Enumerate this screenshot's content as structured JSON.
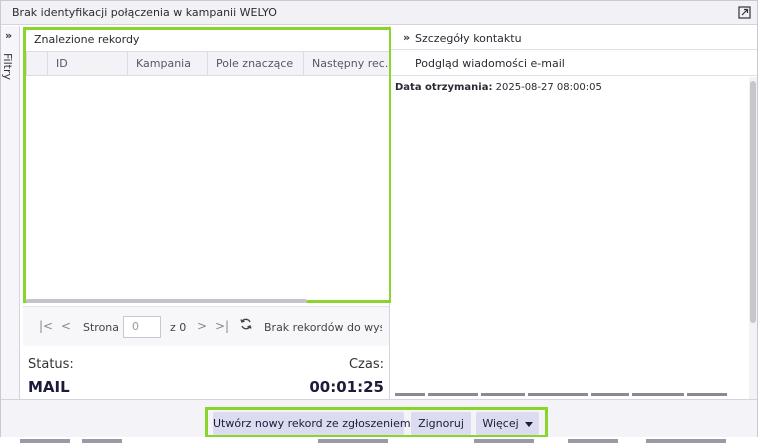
{
  "window": {
    "title": "Brak identyfikacji połączenia w kampanii WELYO"
  },
  "filters": {
    "label": "Filtry"
  },
  "found_records": {
    "title": "Znalezione rekordy",
    "columns": [
      "ID",
      "Kampania",
      "Pole znaczące",
      "Następny rec..."
    ]
  },
  "pager": {
    "page_label": "Strona",
    "page_value": "0",
    "of_label": "z 0",
    "empty_message": "Brak rekordów do wyśw"
  },
  "status": {
    "status_label": "Status:",
    "status_value": "MAIL",
    "time_label": "Czas:",
    "time_value": "00:01:25"
  },
  "contact_details": {
    "header": "Szczegóły kontaktu",
    "tab": "Podgląd wiadomości e-mail",
    "received_label": "Data otrzymania:",
    "received_value": "2025-08-27 08:00:05"
  },
  "footer": {
    "create_button": "Utwórz nowy rekord ze zgłoszeniem",
    "ignore_button": "Zignoruj",
    "more_button": "Więcej"
  },
  "colors": {
    "highlight": "#8ad52b",
    "button_bg": "#dcdcf0",
    "text_dark": "#1d1b3a"
  }
}
